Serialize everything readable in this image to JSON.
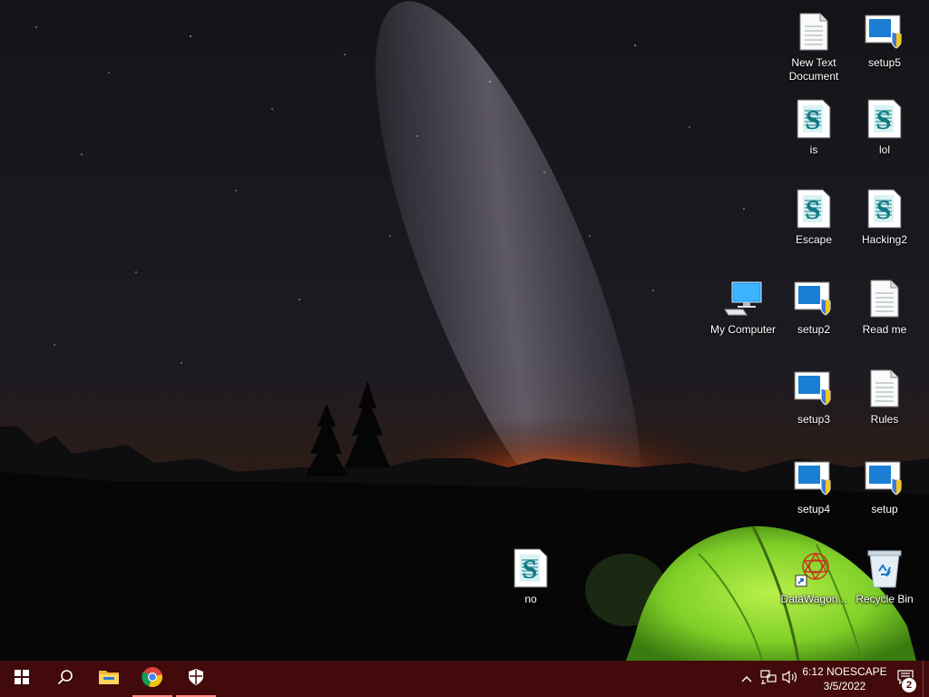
{
  "desktop": {
    "icons": [
      {
        "id": "new-text-document",
        "label": "New Text Document",
        "type": "text-document-icon"
      },
      {
        "id": "setup5",
        "label": "setup5",
        "type": "installer-shield-icon"
      },
      {
        "id": "is",
        "label": "is",
        "type": "script-icon"
      },
      {
        "id": "lol",
        "label": "lol",
        "type": "script-icon"
      },
      {
        "id": "escape",
        "label": "Escape",
        "type": "script-icon"
      },
      {
        "id": "hacking2",
        "label": "Hacking2",
        "type": "script-icon"
      },
      {
        "id": "my-computer",
        "label": "My Computer",
        "type": "computer-icon"
      },
      {
        "id": "setup2",
        "label": "setup2",
        "type": "installer-shield-icon"
      },
      {
        "id": "read-me",
        "label": "Read me",
        "type": "text-document-icon"
      },
      {
        "id": "setup3",
        "label": "setup3",
        "type": "installer-shield-icon"
      },
      {
        "id": "rules",
        "label": "Rules",
        "type": "text-document-icon"
      },
      {
        "id": "setup4",
        "label": "setup4",
        "type": "installer-shield-icon"
      },
      {
        "id": "setup",
        "label": "setup",
        "type": "installer-shield-icon"
      },
      {
        "id": "no",
        "label": "no",
        "type": "script-icon"
      },
      {
        "id": "datawagon",
        "label": "DataWagon...",
        "type": "datawagon-shortcut-icon"
      },
      {
        "id": "recycle-bin",
        "label": "Recycle Bin",
        "type": "recycle-bin-icon"
      }
    ]
  },
  "taskbar": {
    "start": "windows-start-icon",
    "search": "search-icon",
    "pinned": [
      {
        "id": "file-explorer",
        "icon": "folder-icon"
      },
      {
        "id": "chrome",
        "icon": "chrome-icon"
      },
      {
        "id": "security",
        "icon": "shield-icon"
      }
    ],
    "tray": {
      "chevron": "chevron-up-icon",
      "network": "network-icon",
      "volume": "volume-icon",
      "time": "6:12 NOESCAPE",
      "date": "3/5/2022",
      "notifications_count": "2"
    }
  },
  "colors": {
    "taskbar": "#420a0a",
    "accent": "#ff8a80",
    "tent": "#8cd630"
  }
}
